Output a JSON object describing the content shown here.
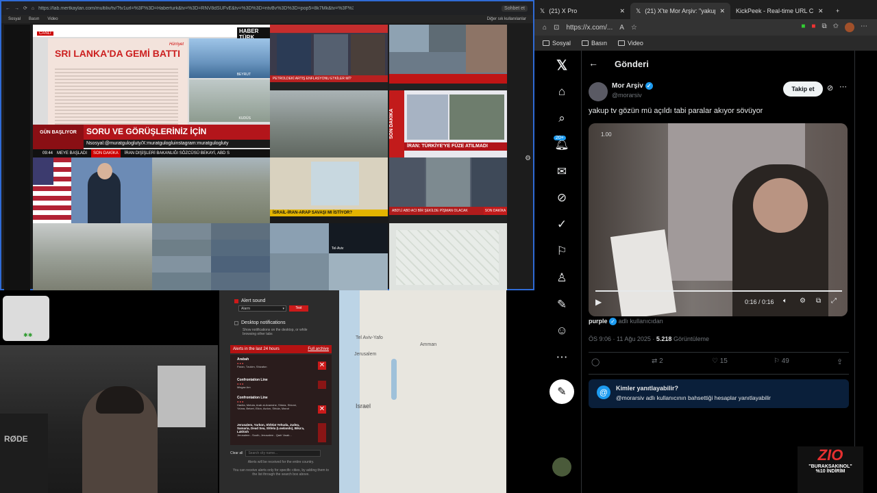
{
  "left_browser": {
    "url": "https://lab.mertkaylan.com/multiliv/tv/?tv1url=%3F%3D=Haberturk&tv=%3D=RNV8dSUFvE&tv=%3D%3D=ntvBv%3D%3D=pop5=8k7Mk&tv=%3F%3D=N-ArabiyaBreak...",
    "bookmarks": [
      "Sosyal",
      "Basın",
      "Video"
    ],
    "extra_bookmark": "Diğer sık kullanılanlar",
    "tabs": [
      "Sohbet et"
    ],
    "tiles": {
      "haberturk_logo": "HABER TÜRK",
      "live_badge": "CANLI",
      "headline": "SRI LANKA'DA GEMİ BATTI",
      "hurriyet": "Hürriyet",
      "beirut": "BEYRUT",
      "kudus": "KUDÜS",
      "gun_basliyor": "GÜN BAŞLIYOR",
      "questions_banner": "SORU VE GÖRÜŞLERİNİZ İÇİN",
      "social_line": "Nsosyal:@muratgulogluty/X:muratgulogluinstagram:muratgulogluty",
      "ticker_time": "09:44",
      "ticker_left": "MEYE BAŞLADI",
      "ticker_mid": "SON DAKİKA",
      "ticker_right": "İRAN DIŞİŞLERİ BAKANLIĞI SÖZCÜSÜ BEKAYİ, ABD S",
      "petrol": "PETROLDEKİ ARTIŞ ENFLASYONU ETKİLER Mİ?",
      "son_dakika": "SON DAKİKA",
      "iran_turkiye": "İRAN: TÜRKİYE'YE FÜZE ATILMADI",
      "israil_iran": "İSRAİL-İRAN-ARAP SAVAŞI MI İSTİYOR?",
      "abd_aci": "ABD'Lİ ABD ACI BİR ŞEKİLDE PİŞMAN OLACAK",
      "tel_aviv": "Tel-Aviv"
    }
  },
  "right_browser": {
    "tabs": [
      {
        "label": "(21) X Pro"
      },
      {
        "label": "(21) X'te Mor Arşiv: \"yakup t",
        "active": true
      },
      {
        "label": "KickPeek - Real-time URL C"
      }
    ],
    "url": "https://x.com/...",
    "bookmarks": [
      "Sosyal",
      "Basın",
      "Video"
    ],
    "notif_badge": "20+"
  },
  "tweet": {
    "header_title": "Gönderi",
    "author_name": "Mor Arşiv",
    "author_handle": "@morarsiv",
    "follow_label": "Takip et",
    "text": "yakup tv gözün mü açıldı tabi paralar akıyor sövüyor",
    "video_time": "0:16 / 0:16",
    "video_overlay_text": "1.00",
    "source_name": "purple",
    "source_suffix": "adlı kullanıcıdan",
    "timestamp": "ÖS 9:06 · 11 Ağu 2025 · ",
    "views": "5.218",
    "views_label": "Görüntüleme",
    "retweets": "2",
    "likes": "15",
    "bookmarks": "49",
    "reply_box_title": "Kimler yanıtlayabilir?",
    "reply_box_text": "@morarsiv adlı kullanıcının bahsettiği hesaplar yanıtlayabilir"
  },
  "alerts": {
    "alert_sound_label": "Alert sound",
    "alarm_select": "Alarm",
    "test_button": "Test",
    "desktop_notif_label": "Desktop notifications",
    "desktop_notif_desc": "Show notifications on the desktop, or while browsing other tabs",
    "last24_label": "Alerts in the last 24 hours",
    "full_archive": "Full archive",
    "items": [
      {
        "title": "Arabah",
        "detail": "Paran, Tzukim, Shizafon"
      },
      {
        "title": "Confrontation Line",
        "detail": "Misgav Am"
      },
      {
        "title": "Confrontation Line",
        "detail": "Hanita, Metula, Arab al-Aramshe, Shtula, Shlomi, Ya'ara, Betzet, Eilon, Avdon, Shtula, Manot"
      },
      {
        "title": "Jerusalem, Yarkon, Shfelat Yehuda, Judea, Samaria, Dead Sea, Shfela (Lowlands), Bika'a, Lakhish",
        "detail": "Jerusalem - South, Jerusalem - Qarir' Asab..."
      }
    ],
    "clear_all": "Clear all",
    "search_placeholder": "Search city name...",
    "footer1": "Alerts will be received for the entire country.",
    "footer2": "You can receive alerts only for specific cities, by adding them to the list through the search box above."
  },
  "map": {
    "labels": {
      "tel_aviv": "Tel Aviv-Yafo",
      "jerusalem": "Jerusalem",
      "amman": "Amman",
      "israel": "Israel"
    }
  },
  "promo": {
    "brand": "ZIO",
    "code": "\"BURAKSAKINOL\"",
    "discount": "%10 İNDİRİM"
  },
  "colors": {
    "x_blue": "#1d9bf0",
    "alert_red": "#cc1a1a",
    "left_border": "#2f6bd6"
  }
}
